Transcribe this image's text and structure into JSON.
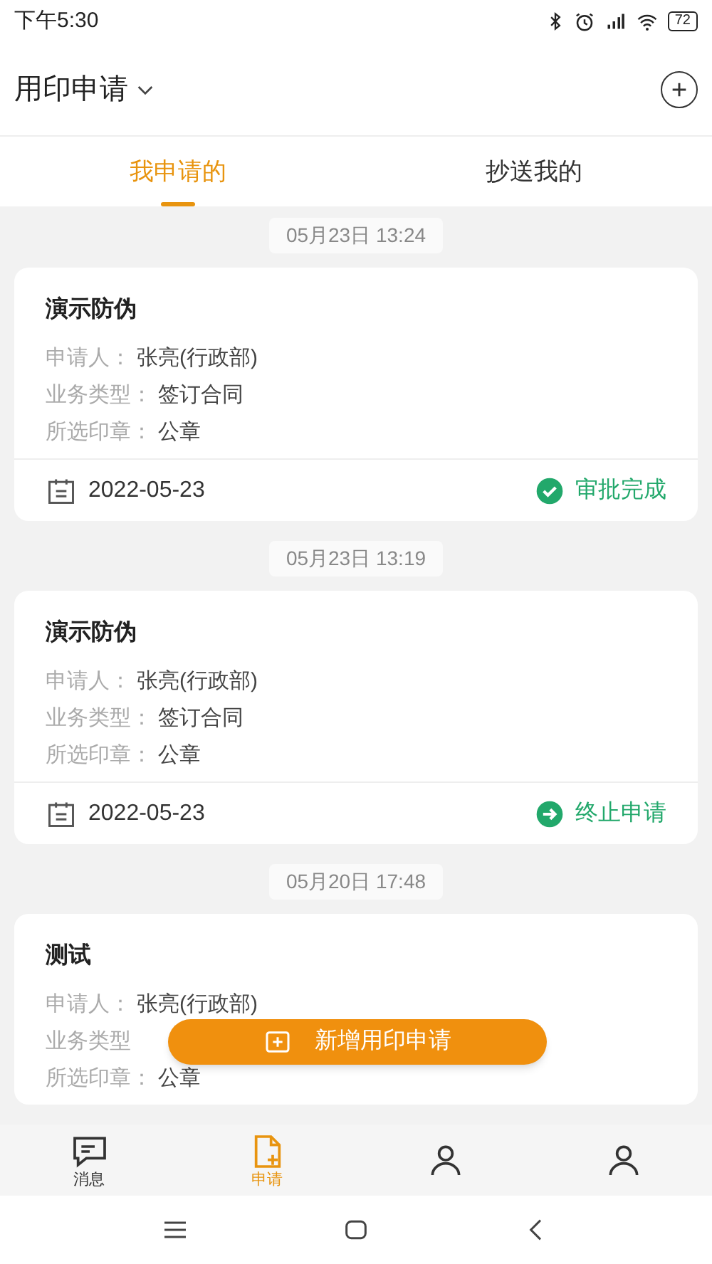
{
  "status_bar": {
    "time": "下午5:30",
    "battery": "72"
  },
  "header": {
    "title": "用印申请"
  },
  "tabs": [
    {
      "label": "我申请的",
      "selected": true
    },
    {
      "label": "抄送我的",
      "selected": false
    }
  ],
  "requests": [
    {
      "timestamp": "05月23日 13:24",
      "title": "演示防伪",
      "fields": [
        {
          "label": "申请人：",
          "value": "张亮(行政部)"
        },
        {
          "label": "业务类型：",
          "value": "签订合同"
        },
        {
          "label": "所选印章：",
          "value": "公章"
        }
      ],
      "date": "2022-05-23",
      "status": {
        "kind": "approved",
        "label": "审批完成"
      }
    },
    {
      "timestamp": "05月23日 13:19",
      "title": "演示防伪",
      "fields": [
        {
          "label": "申请人：",
          "value": "张亮(行政部)"
        },
        {
          "label": "业务类型：",
          "value": "签订合同"
        },
        {
          "label": "所选印章：",
          "value": "公章"
        }
      ],
      "date": "2022-05-23",
      "status": {
        "kind": "terminated",
        "label": "终止申请"
      }
    },
    {
      "timestamp": "05月20日 17:48",
      "title": "测试",
      "fields": [
        {
          "label": "申请人：",
          "value": "张亮(行政部)"
        },
        {
          "label": "业务类型"
        },
        {
          "label": "所选印章：",
          "value": "公章"
        }
      ]
    }
  ],
  "fab": {
    "label": "新增用印申请"
  },
  "bottom_nav": [
    {
      "kind": "message",
      "label": "消息",
      "selected": false
    },
    {
      "kind": "document",
      "label": "申请",
      "selected": true
    },
    {
      "kind": "person",
      "selected": false
    },
    {
      "kind": "person",
      "selected": false
    }
  ]
}
